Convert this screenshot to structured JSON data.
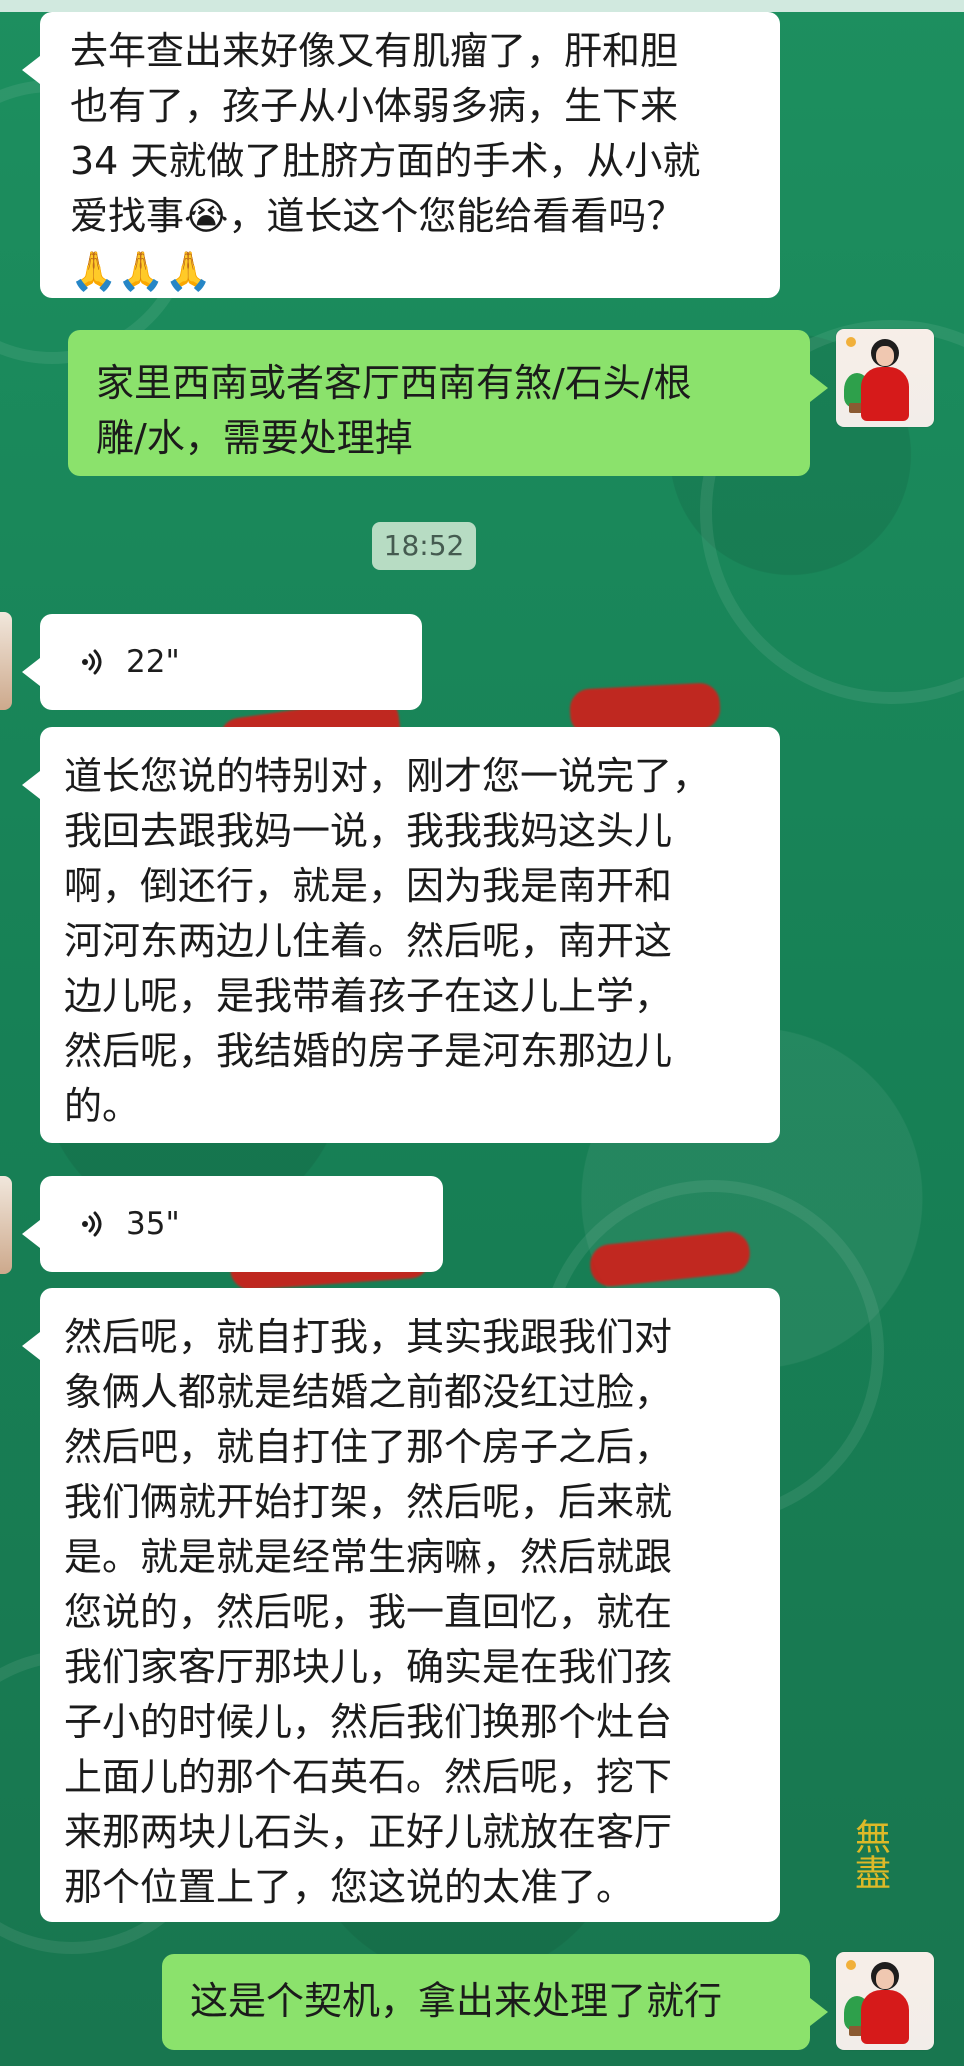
{
  "messages": [
    {
      "side": "left",
      "text": "去年查出来好像又有肌瘤了，肝和胆\n也有了，孩子从小体弱多病，生下来\n34 天就做了肚脐方面的手术，从小就\n爱找事😭，道长这个您能给看看吗？\n🙏🙏🙏"
    },
    {
      "side": "right",
      "text": "家里西南或者客厅西南有煞/石头/根\n雕/水，需要处理掉"
    },
    {
      "type": "time",
      "label": "18:52"
    },
    {
      "side": "left",
      "type": "voice",
      "duration": "22\""
    },
    {
      "side": "left",
      "text": "道长您说的特别对，刚才您一说完了，\n我回去跟我妈一说，我我我妈这头儿\n啊，倒还行，就是，因为我是南开和\n河河东两边儿住着。然后呢，南开这\n边儿呢，是我带着孩子在这儿上学，\n然后呢，我结婚的房子是河东那边儿\n的。"
    },
    {
      "side": "left",
      "type": "voice",
      "duration": "35\""
    },
    {
      "side": "left",
      "text": "然后呢，就自打我，其实我跟我们对\n象俩人都就是结婚之前都没红过脸，\n然后吧，就自打住了那个房子之后，\n我们俩就开始打架，然后呢，后来就\n是。就是就是经常生病嘛，然后就跟\n您说的，然后呢，我一直回忆，就在\n我们家客厅那块儿，确实是在我们孩\n子小的时候儿，然后我们换那个灶台\n上面儿的那个石英石。然后呢，挖下\n来那两块儿石头，正好儿就放在客厅\n那个位置上了，您这说的太准了。"
    },
    {
      "side": "right",
      "text": "这是个契机，拿出来处理了就行"
    }
  ],
  "decorations": {
    "stamp_text": "無盡"
  },
  "icons": {
    "voice": "voice-wave-icon",
    "avatar": "profile-avatar"
  }
}
